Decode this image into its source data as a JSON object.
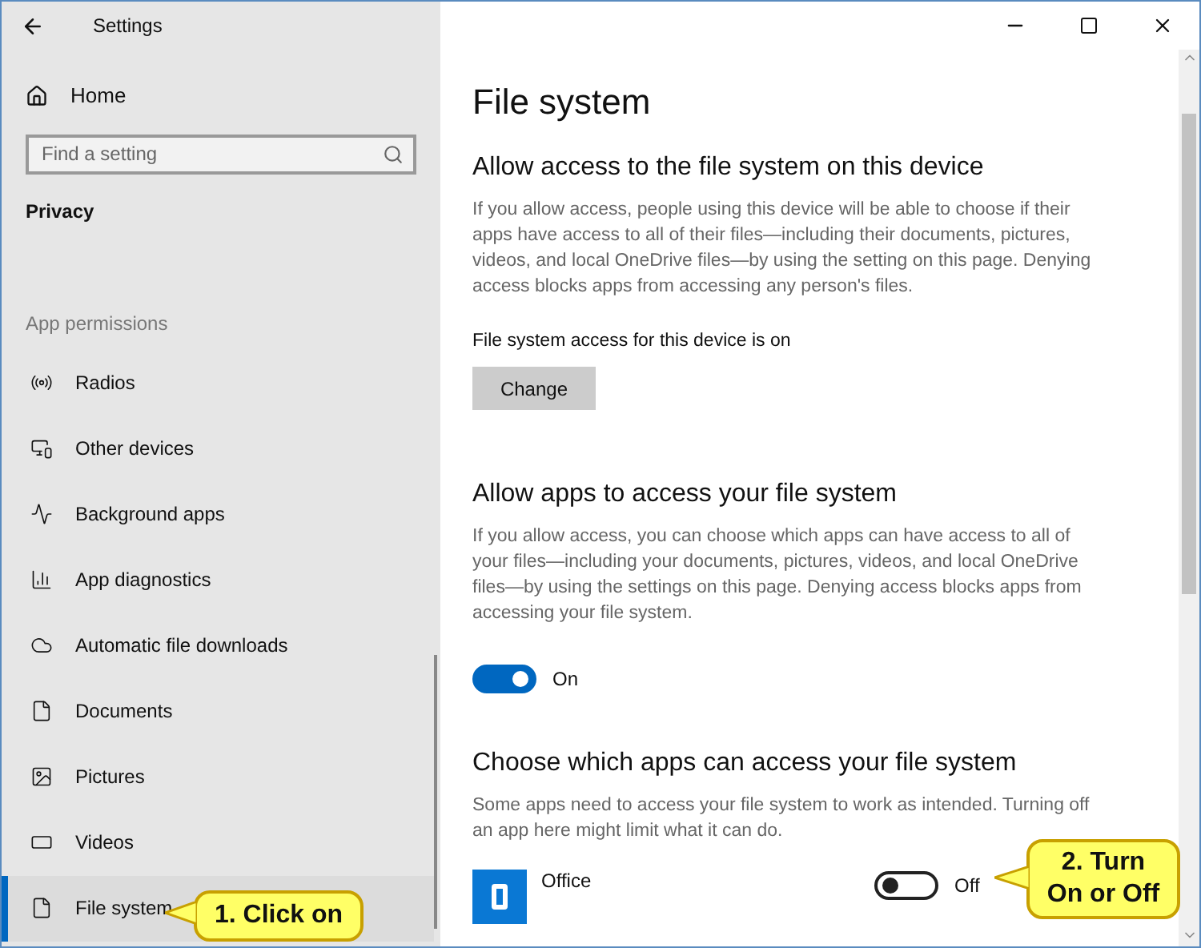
{
  "window": {
    "title": "Settings"
  },
  "sidebar": {
    "home": "Home",
    "search": {
      "placeholder": "Find a setting"
    },
    "section": "Privacy",
    "group": "App permissions",
    "items": [
      {
        "label": "Radios",
        "kind": "radio",
        "selected": false
      },
      {
        "label": "Other devices",
        "kind": "devices",
        "selected": false
      },
      {
        "label": "Background apps",
        "kind": "background",
        "selected": false
      },
      {
        "label": "App diagnostics",
        "kind": "diagnostics",
        "selected": false
      },
      {
        "label": "Automatic file downloads",
        "kind": "cloud",
        "selected": false
      },
      {
        "label": "Documents",
        "kind": "document",
        "selected": false
      },
      {
        "label": "Pictures",
        "kind": "picture",
        "selected": false
      },
      {
        "label": "Videos",
        "kind": "video",
        "selected": false
      },
      {
        "label": "File system",
        "kind": "document",
        "selected": true
      }
    ]
  },
  "page": {
    "title": "File system",
    "device_section": {
      "heading": "Allow access to the file system on this device",
      "text": "If you allow access, people using this device will be able to choose if their apps have access to all of their files—including their documents, pictures, videos, and local OneDrive files—by using the setting on this page. Denying access blocks apps from accessing any person's files.",
      "status": "File system access for this device is on",
      "button": "Change"
    },
    "apps_section": {
      "heading": "Allow apps to access your file system",
      "text": "If you allow access, you can choose which apps can have access to all of your files—including your documents, pictures, videos, and local OneDrive files—by using the settings on this page. Denying access blocks apps from accessing your file system.",
      "toggle": {
        "on": true,
        "label": "On"
      }
    },
    "choose_section": {
      "heading": "Choose which apps can access your file system",
      "text": "Some apps need to access your file system to work as intended. Turning off an app here might limit what it can do.",
      "apps": [
        {
          "name": "Office",
          "on": false,
          "label": "Off"
        }
      ]
    }
  },
  "callouts": [
    "1. Click on",
    "2. Turn On or Off"
  ]
}
